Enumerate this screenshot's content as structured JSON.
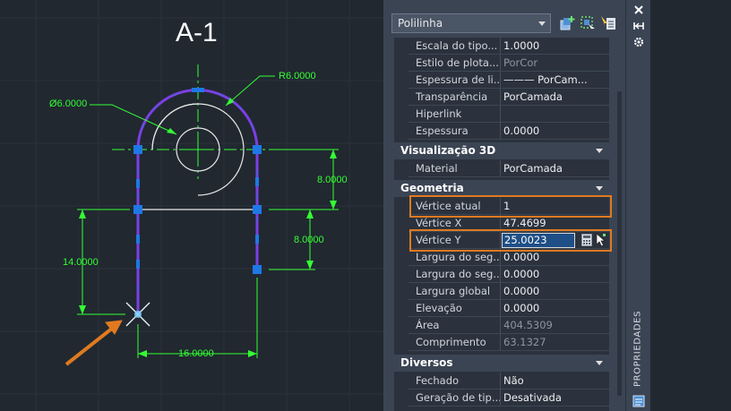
{
  "drawing": {
    "title": "A-1",
    "dimensions": {
      "radius": "R6.0000",
      "diameter": "Ø6.0000",
      "height_right_upper": "8.0000",
      "height_right_lower": "8.0000",
      "height_left": "14.0000",
      "width_bottom": "16.0000"
    },
    "colors": {
      "background": "#212830",
      "polyline": "#7b3fe4",
      "dimension": "#33ff33",
      "grip": "#1e78e6",
      "arrow": "#e07a1f"
    }
  },
  "panel": {
    "object_type": "Polilinha",
    "toolbar": [
      "quick-select-icon",
      "select-objects-icon",
      "toggle-pickadd-icon"
    ],
    "general_rows": [
      {
        "label": "Escala do tipo...",
        "value": "1.0000",
        "muted": false
      },
      {
        "label": "Estilo de plota...",
        "value": "PorCor",
        "muted": true
      },
      {
        "label": "Espessura de li...",
        "value": "——— PorCam...",
        "muted": false
      },
      {
        "label": "Transparência",
        "value": "PorCamada",
        "muted": false
      },
      {
        "label": "Hiperlink",
        "value": "",
        "muted": false
      },
      {
        "label": "Espessura",
        "value": "0.0000",
        "muted": false
      }
    ],
    "section_3d": {
      "title": "Visualização 3D",
      "rows": [
        {
          "label": "Material",
          "value": "PorCamada",
          "muted": false
        }
      ]
    },
    "section_geometry": {
      "title": "Geometria",
      "current_vertex": {
        "label": "Vértice atual",
        "value": "1"
      },
      "vertex_x": {
        "label": "Vértice X",
        "value": "47.4699"
      },
      "vertex_y": {
        "label": "Vértice Y",
        "value": "25.0023"
      },
      "rows": [
        {
          "label": "Largura do seg...",
          "value": "0.0000",
          "muted": false
        },
        {
          "label": "Largura do seg...",
          "value": "0.0000",
          "muted": false
        },
        {
          "label": "Largura global",
          "value": "0.0000",
          "muted": false
        },
        {
          "label": "Elevação",
          "value": "0.0000",
          "muted": false
        },
        {
          "label": "Área",
          "value": "404.5309",
          "muted": true
        },
        {
          "label": "Comprimento",
          "value": "63.1327",
          "muted": true
        }
      ]
    },
    "section_misc": {
      "title": "Diversos",
      "rows": [
        {
          "label": "Fechado",
          "value": "Não",
          "muted": false
        },
        {
          "label": "Geração de tip...",
          "value": "Desativada",
          "muted": false
        }
      ]
    },
    "side_label": "PROPRIEDADES",
    "side_icons": [
      "close-icon",
      "auto-hide-icon",
      "settings-icon",
      "properties-icon"
    ],
    "highlight_color": "#e07a1f"
  }
}
